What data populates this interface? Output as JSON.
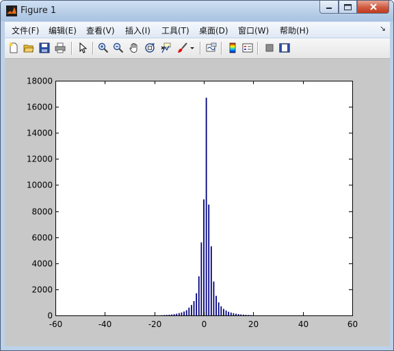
{
  "window": {
    "title": "Figure 1",
    "controls": {
      "minimize": "minimize",
      "maximize": "maximize",
      "close": "close"
    }
  },
  "menu": [
    {
      "label": "文件(F)"
    },
    {
      "label": "编辑(E)"
    },
    {
      "label": "查看(V)"
    },
    {
      "label": "插入(I)"
    },
    {
      "label": "工具(T)"
    },
    {
      "label": "桌面(D)"
    },
    {
      "label": "窗口(W)"
    },
    {
      "label": "帮助(H)"
    }
  ],
  "toolbar": [
    {
      "icon": "new-figure-icon"
    },
    {
      "icon": "open-file-icon"
    },
    {
      "icon": "save-icon"
    },
    {
      "icon": "print-icon"
    },
    {
      "icon": "pointer-icon"
    },
    {
      "icon": "zoom-in-icon"
    },
    {
      "icon": "zoom-out-icon"
    },
    {
      "icon": "pan-hand-icon"
    },
    {
      "icon": "rotate-3d-icon"
    },
    {
      "icon": "data-cursor-icon"
    },
    {
      "icon": "brush-icon"
    },
    {
      "icon": "link-plot-icon"
    },
    {
      "icon": "colorbar-icon"
    },
    {
      "icon": "legend-icon"
    },
    {
      "icon": "hide-plot-tools-icon"
    },
    {
      "icon": "show-plot-tools-icon"
    }
  ],
  "chart_data": {
    "type": "bar",
    "title": "",
    "xlabel": "",
    "ylabel": "",
    "xlim": [
      -60,
      60
    ],
    "ylim": [
      0,
      18000
    ],
    "xticks": [
      -60,
      -40,
      -20,
      0,
      20,
      40,
      60
    ],
    "yticks": [
      0,
      2000,
      4000,
      6000,
      8000,
      10000,
      12000,
      14000,
      16000,
      18000
    ],
    "bar_color": "#00007f",
    "series": [
      {
        "x": [
          -17,
          -16,
          -15,
          -14,
          -13,
          -12,
          -11,
          -10,
          -9,
          -8,
          -7,
          -6,
          -5,
          -4,
          -3,
          -2,
          -1,
          0,
          1,
          2,
          3,
          4,
          5,
          6,
          7,
          8,
          9,
          10,
          11,
          12,
          13,
          14,
          15,
          16,
          17,
          18,
          19
        ],
        "values": [
          20,
          30,
          40,
          55,
          70,
          100,
          130,
          180,
          230,
          300,
          400,
          600,
          800,
          1100,
          1700,
          3000,
          5600,
          8900,
          16700,
          8500,
          5300,
          2600,
          1500,
          1000,
          700,
          500,
          380,
          280,
          220,
          170,
          130,
          100,
          80,
          60,
          45,
          35,
          25
        ]
      }
    ]
  }
}
